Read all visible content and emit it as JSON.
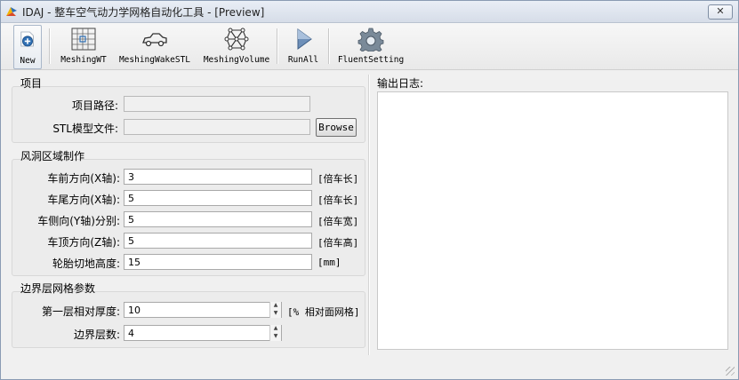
{
  "window": {
    "title": "IDAJ - 整车空气动力学网格自动化工具 - [Preview]",
    "close_label": "✕"
  },
  "toolbar": {
    "new_label": "New",
    "meshing_wt_label": "MeshingWT",
    "meshing_wake_stl_label": "MeshingWakeSTL",
    "meshing_volume_label": "MeshingVolume",
    "run_all_label": "RunAll",
    "fluent_setting_label": "FluentSetting"
  },
  "project": {
    "title": "项目",
    "path_label": "项目路径:",
    "path_value": "",
    "stl_label": "STL模型文件:",
    "stl_value": "",
    "browse_label": "Browse"
  },
  "wind_tunnel": {
    "title": "风洞区域制作",
    "rows": [
      {
        "label": "车前方向(X轴):",
        "value": "3",
        "unit": "[倍车长]"
      },
      {
        "label": "车尾方向(X轴):",
        "value": "5",
        "unit": "[倍车长]"
      },
      {
        "label": "车侧向(Y轴)分别:",
        "value": "5",
        "unit": "[倍车宽]"
      },
      {
        "label": "车顶方向(Z轴):",
        "value": "5",
        "unit": "[倍车高]"
      },
      {
        "label": "轮胎切地高度:",
        "value": "15",
        "unit": "[mm]"
      }
    ]
  },
  "boundary_layer": {
    "title": "边界层网格参数",
    "first_layer_label": "第一层相对厚度:",
    "first_layer_value": "10",
    "first_layer_unit": "[% 相对面网格]",
    "layer_count_label": "边界层数:",
    "layer_count_value": "4"
  },
  "log": {
    "title": "输出日志:",
    "content": ""
  },
  "icons": {
    "app": "idaj-logo-icon",
    "new": "new-document-icon",
    "meshing_wt": "grid-mesh-icon",
    "meshing_wake_stl": "car-icon",
    "meshing_volume": "volume-mesh-icon",
    "run_all": "play-triangle-icon",
    "fluent_setting": "gear-icon"
  },
  "colors": {
    "accent": "#2f6fb3",
    "titlebar": "#dfe5ee"
  }
}
